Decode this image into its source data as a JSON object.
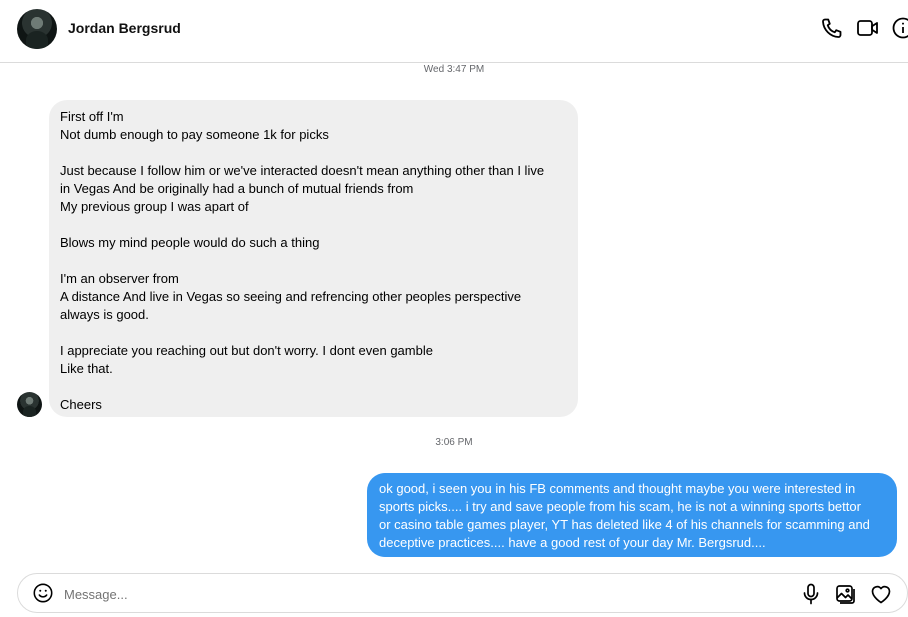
{
  "header": {
    "contact_name": "Jordan Bergsrud",
    "icons": [
      "phone-icon",
      "video-icon",
      "info-icon"
    ]
  },
  "thread": {
    "timestamp_1": "Wed 3:47 PM",
    "incoming_lines": [
      "First off I'm",
      "Not dumb enough to pay someone 1k for picks",
      "",
      "Just because I follow him or we've interacted doesn't mean anything other than I live",
      "in Vegas And be originally had a bunch of mutual friends from",
      "My previous group I was apart of",
      "",
      "Blows my mind people would do such a thing",
      "",
      "I'm an observer from",
      "A distance And live in Vegas so seeing and refrencing other peoples perspective",
      "always is good.",
      "",
      "I appreciate you reaching out but don't worry. I dont even gamble",
      "Like that.",
      "",
      "Cheers"
    ],
    "timestamp_2": "3:06 PM",
    "outgoing_lines": [
      "ok good, i seen you in his FB comments and thought maybe you were interested in",
      "sports picks.... i try and save people from his scam, he is not a winning sports bettor",
      "or casino table games player, YT has deleted like 4 of his channels for scamming and",
      "deceptive practices.... have a good rest of your day Mr. Bergsrud...."
    ]
  },
  "composer": {
    "placeholder": "Message...",
    "icons": [
      "emoji-icon",
      "microphone-icon",
      "image-icon",
      "heart-icon"
    ]
  },
  "colors": {
    "outgoing_bubble": "#3797f0",
    "incoming_bubble": "#efefef"
  }
}
